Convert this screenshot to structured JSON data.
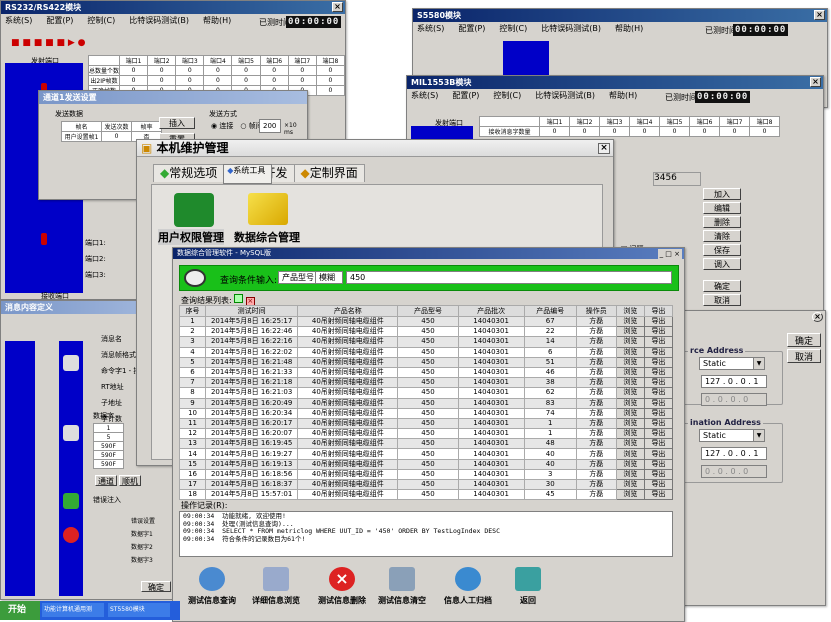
{
  "rs232": {
    "title": "RS232/RS422模块",
    "menu": [
      "系统(S)",
      "配置(P)",
      "控制(C)",
      "比特误码测试(B)",
      "帮助(H)"
    ],
    "elapsed_label": "已测时间",
    "elapsed": "00:00:00",
    "channel_label": "发射端口",
    "cols": [
      "端口1",
      "端口2",
      "端口3",
      "端口4",
      "端口5",
      "端口6",
      "端口7",
      "端口8"
    ],
    "rows": [
      "总数量个数",
      "出2IP帧数",
      "正确帧数"
    ],
    "ports": [
      "端口1:",
      "端口2:",
      "端口3:",
      "端口4:"
    ],
    "recv_label": "接收端口"
  },
  "comm": {
    "title": "通道1发送设置",
    "send_label": "发送数据",
    "headers": [
      "帧名",
      "发送次数",
      "帧率"
    ],
    "row": [
      "用户设置帧1",
      "0",
      "否"
    ],
    "insert": "插入",
    "reset": "重置",
    "mode_label": "发送方式",
    "mode_a": "连接",
    "mode_b": "帧间隔",
    "interval": "200",
    "unit": "×10 ms"
  },
  "s5580": {
    "title": "S5580模块",
    "menu": [
      "系统(S)",
      "配置(P)",
      "控制(C)",
      "比特误码测试(B)",
      "帮助(H)"
    ],
    "elapsed_label": "已测时间",
    "elapsed": "00:00:00"
  },
  "mil": {
    "title": "MIL1553B模块",
    "menu": [
      "系统(S)",
      "配置(P)",
      "控制(C)",
      "比特误码测试(B)",
      "帮助(H)"
    ],
    "elapsed_label": "已测时间",
    "elapsed": "00:00:00",
    "channel_label": "发射端口",
    "row": "接收消息字数量",
    "btns": [
      "加入",
      "编辑",
      "删除",
      "清除",
      "保存",
      "调入"
    ],
    "confirm": "确定",
    "cancel": "取消",
    "hex": "3456",
    "check": "间隔"
  },
  "maint": {
    "title": "本机维护管理",
    "tabs": [
      "常规选项",
      "系统工具",
      "测试开发",
      "定制界面"
    ],
    "tools": [
      "用户权限管理",
      "数据综合管理"
    ]
  },
  "db": {
    "title": "数据综合管理软件 - MySQL版",
    "query_label": "查询条件输入:",
    "field1": "产品型号",
    "field2": "模糊",
    "value": "450",
    "result_label": "查询结果列表:",
    "headers": [
      "序号",
      "测试时间",
      "产品名称",
      "产品型号",
      "产品批次",
      "产品编号",
      "操作员",
      "浏览",
      "导出"
    ],
    "rows": [
      [
        "1",
        "2014年5月8日 16:25:17",
        "40吊射频同轴电缆组件",
        "450",
        "14040301",
        "67",
        "方磊",
        "浏览",
        "导出"
      ],
      [
        "2",
        "2014年5月8日 16:22:46",
        "40吊射频同轴电缆组件",
        "450",
        "14040301",
        "22",
        "方磊",
        "浏览",
        "导出"
      ],
      [
        "3",
        "2014年5月8日 16:22:16",
        "40吊射频同轴电缆组件",
        "450",
        "14040301",
        "14",
        "方磊",
        "浏览",
        "导出"
      ],
      [
        "4",
        "2014年5月8日 16:22:02",
        "40吊射频同轴电缆组件",
        "450",
        "14040301",
        "6",
        "方磊",
        "浏览",
        "导出"
      ],
      [
        "5",
        "2014年5月8日 16:21:48",
        "40吊射频同轴电缆组件",
        "450",
        "14040301",
        "51",
        "方磊",
        "浏览",
        "导出"
      ],
      [
        "6",
        "2014年5月8日 16:21:33",
        "40吊射频同轴电缆组件",
        "450",
        "14040301",
        "46",
        "方磊",
        "浏览",
        "导出"
      ],
      [
        "7",
        "2014年5月8日 16:21:18",
        "40吊射频同轴电缆组件",
        "450",
        "14040301",
        "38",
        "方磊",
        "浏览",
        "导出"
      ],
      [
        "8",
        "2014年5月8日 16:21:03",
        "40吊射频同轴电缆组件",
        "450",
        "14040301",
        "62",
        "方磊",
        "浏览",
        "导出"
      ],
      [
        "9",
        "2014年5月8日 16:20:49",
        "40吊射频同轴电缆组件",
        "450",
        "14040301",
        "83",
        "方磊",
        "浏览",
        "导出"
      ],
      [
        "10",
        "2014年5月8日 16:20:34",
        "40吊射频同轴电缆组件",
        "450",
        "14040301",
        "74",
        "方磊",
        "浏览",
        "导出"
      ],
      [
        "11",
        "2014年5月8日 16:20:17",
        "40吊射频同轴电缆组件",
        "450",
        "14040301",
        "1",
        "方磊",
        "浏览",
        "导出"
      ],
      [
        "12",
        "2014年5月8日 16:20:07",
        "40吊射频同轴电缆组件",
        "450",
        "14040301",
        "1",
        "方磊",
        "浏览",
        "导出"
      ],
      [
        "13",
        "2014年5月8日 16:19:45",
        "40吊射频同轴电缆组件",
        "450",
        "14040301",
        "48",
        "方磊",
        "浏览",
        "导出"
      ],
      [
        "14",
        "2014年5月8日 16:19:27",
        "40吊射频同轴电缆组件",
        "450",
        "14040301",
        "40",
        "方磊",
        "浏览",
        "导出"
      ],
      [
        "15",
        "2014年5月8日 16:19:13",
        "40吊射频同轴电缆组件",
        "450",
        "14040301",
        "40",
        "方磊",
        "浏览",
        "导出"
      ],
      [
        "16",
        "2014年5月8日 16:18:56",
        "40吊射频同轴电缆组件",
        "450",
        "14040301",
        "3",
        "方磊",
        "浏览",
        "导出"
      ],
      [
        "17",
        "2014年5月8日 16:18:37",
        "40吊射频同轴电缆组件",
        "450",
        "14040301",
        "30",
        "方磊",
        "浏览",
        "导出"
      ],
      [
        "18",
        "2014年5月8日 15:57:01",
        "40吊射频同轴电缆组件",
        "450",
        "14040301",
        "45",
        "方磊",
        "浏览",
        "导出"
      ]
    ],
    "log_label": "操作记录(R):",
    "log": "09:00:34  功能就绪, 欢迎使用!\n09:00:34  处理(测试信息查询)...\n09:00:34  SELECT * FROM metriclog WHERE UUT_ID = '450' ORDER BY TestLogIndex DESC\n09:00:34  符合条件的记录数目为61个!",
    "buttons": [
      "测试信息查询",
      "详细信息浏览",
      "测试信息删除",
      "测试信息清空",
      "信息人工归档",
      "返回"
    ]
  },
  "ip": {
    "confirm": "确定",
    "cancel": "取消",
    "src": "rce Address",
    "dst": "ination Address",
    "mode": "Static",
    "ip": "127 . 0 . 0 . 1",
    "zero": "0 . 0 . 0 . 0"
  },
  "msg": {
    "title": "消息内容定义",
    "fields": [
      "消息名",
      "消息帧格式",
      "命令字1 - 接收",
      "RT地址",
      "子地址",
      "字计数"
    ],
    "data_label": "数据字",
    "dvals": [
      "1",
      "5",
      "590F",
      "590F",
      "590F"
    ],
    "tabs": [
      "通道",
      "顺机"
    ],
    "err_label": "错误注入",
    "efields": [
      "错误设置",
      "数据字1",
      "数据字2",
      "数据字3"
    ],
    "ok": "确定"
  },
  "taskbar": {
    "start": "开始",
    "items": [
      "S5580模块",
      "功能计算机通用测",
      "ST5580模块"
    ]
  }
}
